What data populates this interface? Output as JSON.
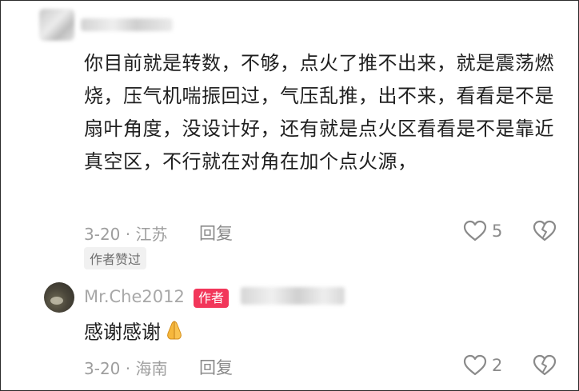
{
  "comment1": {
    "text": "你目前就是转数，不够，点火了推不出来，就是震荡燃烧，压气机喘振回过，气压乱推，出不来，看看是不是扇叶角度，没设计好，还有就是点火区看看是不是靠近真空区，不行就在对角在加个点火源，",
    "date_location": "3-20 · 江苏",
    "reply_label": "回复",
    "like_count": "5",
    "author_liked_label": "作者赞过"
  },
  "comment2": {
    "username": "Mr.Che2012",
    "author_badge": "作者",
    "text": "感谢感谢",
    "emoji": "folded-hands-icon",
    "date_location": "3-20 · 海南",
    "reply_label": "回复",
    "like_count": "2"
  },
  "colors": {
    "author_badge": "#f2365a",
    "meta_text": "#9e9e9e",
    "body_text": "#1f1f1f"
  }
}
